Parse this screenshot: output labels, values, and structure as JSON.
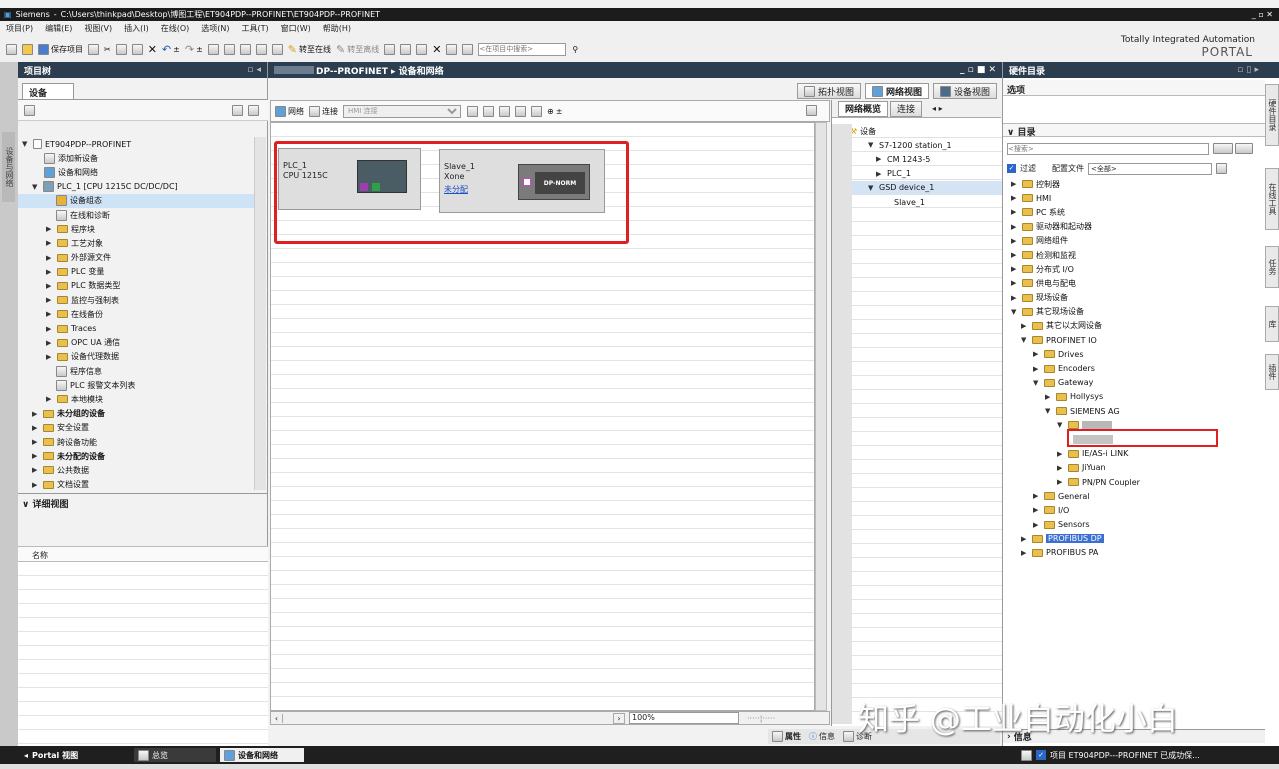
{
  "window": {
    "app": "Siemens",
    "path": "C:\\Users\\thinkpad\\Desktop\\博图工程\\ET904PDP--PROFINET\\ET904PDP--PROFINET",
    "controls": "_ ▫ ✕"
  },
  "menu": [
    "项目(P)",
    "编辑(E)",
    "视图(V)",
    "插入(I)",
    "在线(O)",
    "选项(N)",
    "工具(T)",
    "窗口(W)",
    "帮助(H)"
  ],
  "toolbar": {
    "save": "保存项目",
    "go_online": "转至在线",
    "go_offline": "转至离线",
    "search_placeholder": "<在项目中搜索>"
  },
  "brand": {
    "line1": "Totally Integrated Automation",
    "line2": "PORTAL"
  },
  "project_tree": {
    "header": "项目树",
    "devices_tab": "设备",
    "side_tab": "设备与网络",
    "items": [
      "ET904PDP--PROFINET",
      "添加新设备",
      "设备和网络",
      "PLC_1 [CPU 1215C DC/DC/DC]",
      "设备组态",
      "在线和诊断",
      "程序块",
      "工艺对象",
      "外部源文件",
      "PLC 变量",
      "PLC 数据类型",
      "监控与强制表",
      "在线备份",
      "Traces",
      "OPC UA 通信",
      "设备代理数据",
      "程序信息",
      "PLC 报警文本列表",
      "本地模块",
      "未分组的设备",
      "安全设置",
      "跨设备功能",
      "未分配的设备",
      "公共数据",
      "文档设置"
    ],
    "detail_view": "详细视图",
    "name_col": "名称"
  },
  "editor": {
    "title": "DP--PROFINET ▸ 设备和网络",
    "tabs": {
      "topology": "拓扑视图",
      "network": "网络视图",
      "device": "设备视图"
    },
    "toolbar": {
      "network": "网络",
      "connect": "连接",
      "hmi_placeholder": "HMI 连接"
    },
    "zoom": "100%",
    "plc": {
      "name": "PLC_1",
      "type": "CPU 1215C"
    },
    "slave": {
      "name": "Slave_1",
      "type": "Xone",
      "link": "未分配",
      "module": "DP-NORM"
    }
  },
  "overview": {
    "tabs": [
      "网络概览",
      "连接"
    ],
    "col": "设备",
    "rows": [
      "S7-1200 station_1",
      "CM 1243-5",
      "PLC_1",
      "GSD device_1",
      "Slave_1"
    ]
  },
  "catalog": {
    "header": "硬件目录",
    "options": "选项",
    "catalog": "目录",
    "search": "<搜索>",
    "filter": "过滤",
    "profile_label": "配置文件",
    "profile_value": "<全部>",
    "items": [
      "控制器",
      "HMI",
      "PC 系统",
      "驱动器和起动器",
      "网络组件",
      "检测和监视",
      "分布式 I/O",
      "供电与配电",
      "现场设备",
      "其它现场设备",
      "其它以太网设备",
      "PROFINET IO",
      "Drives",
      "Encoders",
      "Gateway",
      "Hollysys",
      "SIEMENS AG",
      "IE/AS-i LINK",
      "JiYuan",
      "PN/PN Coupler",
      "General",
      "I/O",
      "Sensors",
      "PROFIBUS DP",
      "PROFIBUS PA"
    ],
    "side_tabs": [
      "硬件目录",
      "在线工具",
      "任务",
      "库",
      "插件"
    ]
  },
  "bottom": {
    "properties": "属性",
    "info": "信息",
    "diagnostics": "诊断",
    "info_panel": "信息",
    "portal": "Portal 视图",
    "overview": "总览",
    "devices": "设备和网络",
    "status": "项目 ET904PDP---PROFINET 已成功保..."
  },
  "watermark": "知乎 @工业自动化小白",
  "colors": {
    "title_bar": "#1c1c1c",
    "panel_header": "#2b3d4f",
    "highlight": "#e02020",
    "accent": "#3b6fd1"
  }
}
